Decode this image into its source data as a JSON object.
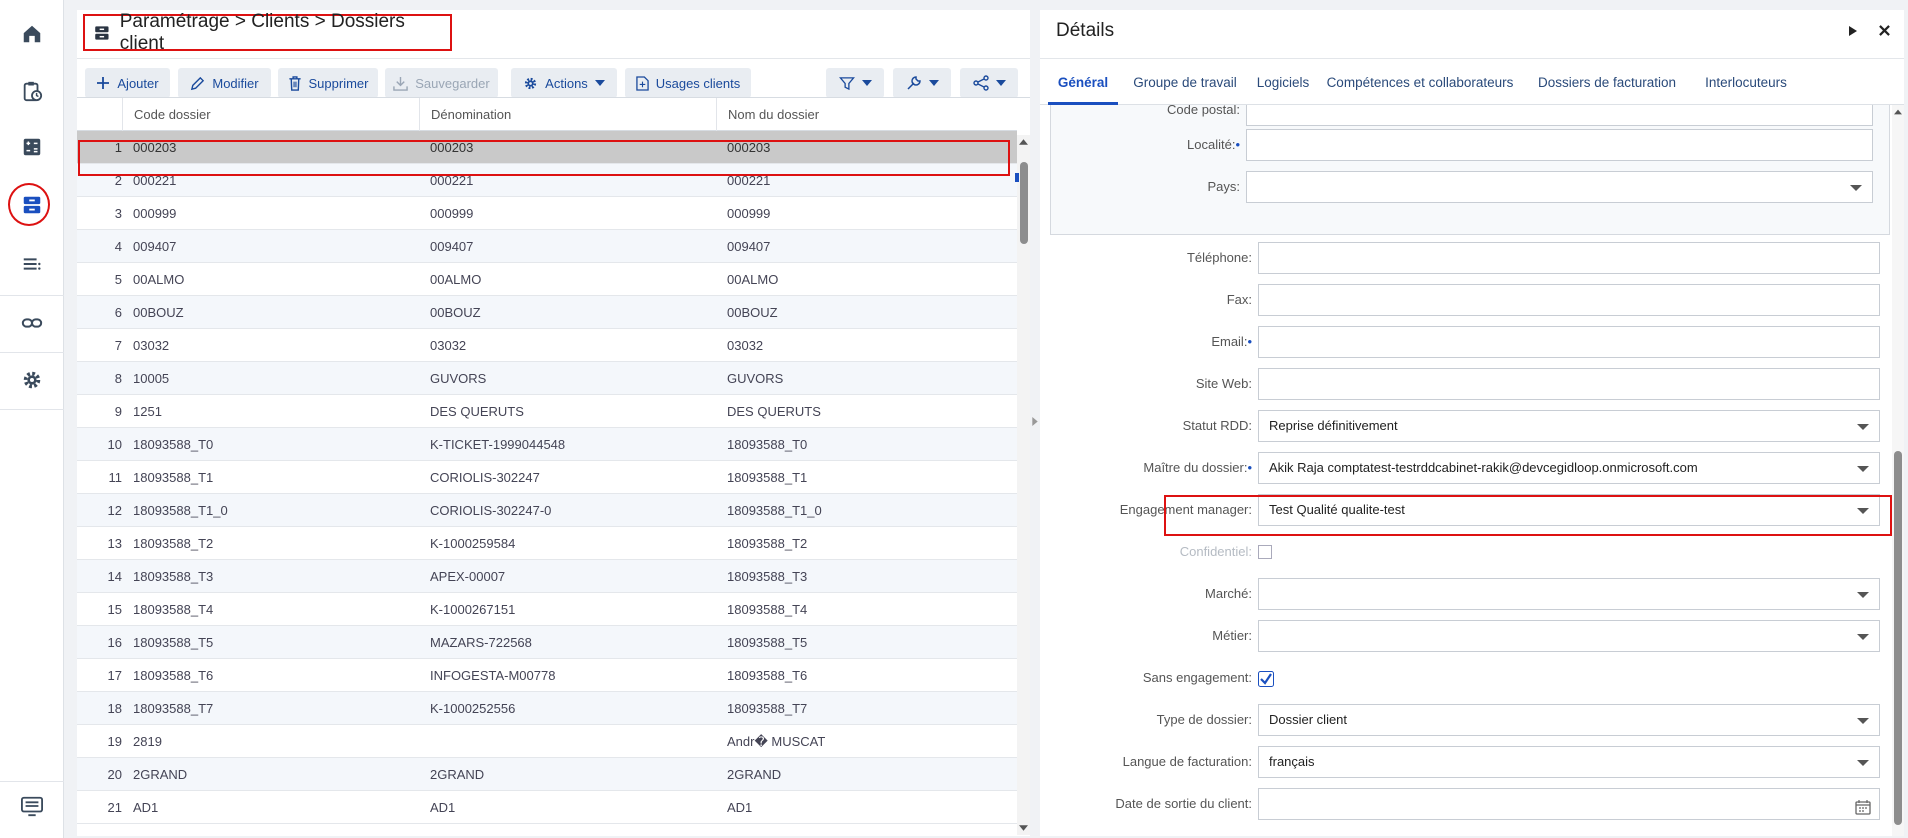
{
  "sidebar": {
    "items": [
      {
        "name": "home-icon"
      },
      {
        "name": "clipboard-clock-icon"
      },
      {
        "name": "calculator-icon"
      },
      {
        "name": "archive-icon"
      },
      {
        "name": "list-icon"
      },
      {
        "name": "link-icon"
      },
      {
        "name": "gear-icon"
      },
      {
        "name": "remote-desktop-icon"
      }
    ]
  },
  "header": {
    "title": "Paramétrage > Clients > Dossiers client"
  },
  "toolbar": {
    "add": "Ajouter",
    "edit": "Modifier",
    "delete": "Supprimer",
    "save": "Sauvegarder",
    "actions": "Actions",
    "usages": "Usages clients"
  },
  "grid": {
    "columns": [
      "Code dossier",
      "Dénomination",
      "Nom du dossier"
    ],
    "rows": [
      [
        "1",
        "000203",
        "000203",
        "000203"
      ],
      [
        "2",
        "000221",
        "000221",
        "000221"
      ],
      [
        "3",
        "000999",
        "000999",
        "000999"
      ],
      [
        "4",
        "009407",
        "009407",
        "009407"
      ],
      [
        "5",
        "00ALMO",
        "00ALMO",
        "00ALMO"
      ],
      [
        "6",
        "00BOUZ",
        "00BOUZ",
        "00BOUZ"
      ],
      [
        "7",
        "03032",
        "03032",
        "03032"
      ],
      [
        "8",
        "10005",
        "GUVORS",
        "GUVORS"
      ],
      [
        "9",
        "1251",
        "DES QUERUTS",
        "DES QUERUTS"
      ],
      [
        "10",
        "18093588_T0",
        "K-TICKET-1999044548",
        "18093588_T0"
      ],
      [
        "11",
        "18093588_T1",
        "CORIOLIS-302247",
        "18093588_T1"
      ],
      [
        "12",
        "18093588_T1_0",
        "CORIOLIS-302247-0",
        "18093588_T1_0"
      ],
      [
        "13",
        "18093588_T2",
        "K-1000259584",
        "18093588_T2"
      ],
      [
        "14",
        "18093588_T3",
        "APEX-00007",
        "18093588_T3"
      ],
      [
        "15",
        "18093588_T4",
        "K-1000267151",
        "18093588_T4"
      ],
      [
        "16",
        "18093588_T5",
        "MAZARS-722568",
        "18093588_T5"
      ],
      [
        "17",
        "18093588_T6",
        "INFOGESTA-M00778",
        "18093588_T6"
      ],
      [
        "18",
        "18093588_T7",
        "K-1000252556",
        "18093588_T7"
      ],
      [
        "19",
        "2819",
        "",
        "Andr� MUSCAT"
      ],
      [
        "20",
        "2GRAND",
        "2GRAND",
        "2GRAND"
      ],
      [
        "21",
        "AD1",
        "AD1",
        "AD1"
      ]
    ],
    "selected_row": 1
  },
  "details": {
    "title": "Détails",
    "tabs": [
      "Général",
      "Groupe de travail",
      "Logiciels",
      "Compétences et collaborateurs",
      "Dossiers de facturation",
      "Interlocuteurs"
    ],
    "active_tab": "Général",
    "address_fields": [
      {
        "label": "Code postal:",
        "value": "",
        "required": false,
        "dropdown": false
      },
      {
        "label": "Localité:",
        "value": "",
        "required": true,
        "dropdown": false
      },
      {
        "label": "Pays:",
        "value": "",
        "required": false,
        "dropdown": true
      }
    ],
    "fields": [
      {
        "label": "Téléphone:",
        "value": "",
        "required": false,
        "dropdown": false
      },
      {
        "label": "Fax:",
        "value": "",
        "required": false,
        "dropdown": false
      },
      {
        "label": "Email:",
        "value": "",
        "required": true,
        "dropdown": false
      },
      {
        "label": "Site Web:",
        "value": "",
        "required": false,
        "dropdown": false
      },
      {
        "label": "Statut RDD:",
        "value": "Reprise définitivement",
        "required": false,
        "dropdown": true
      },
      {
        "label": "Maître du dossier:",
        "value": "Akik Raja comptatest-testrddcabinet-rakik@devcegidloop.onmicrosoft.com",
        "required": true,
        "dropdown": true
      },
      {
        "label": "Engagement manager:",
        "value": "Test Qualité qualite-test",
        "required": false,
        "dropdown": true
      },
      {
        "label": "Confidentiel:",
        "checkbox": false,
        "disabled": true
      },
      {
        "label": "Marché:",
        "value": "",
        "required": false,
        "dropdown": true
      },
      {
        "label": "Métier:",
        "value": "",
        "required": false,
        "dropdown": true
      },
      {
        "label": "Sans engagement:",
        "checkbox": true
      },
      {
        "label": "Type de dossier:",
        "value": "Dossier client",
        "required": false,
        "dropdown": true
      },
      {
        "label": "Langue de facturation:",
        "value": "français",
        "required": false,
        "dropdown": true
      },
      {
        "label": "Date de sortie du client:",
        "value": "",
        "required": false,
        "calendar": true
      }
    ]
  },
  "colors": {
    "accent": "#1a4fbf",
    "highlight": "#dd1111",
    "selected_row": "#c9c9c9"
  }
}
